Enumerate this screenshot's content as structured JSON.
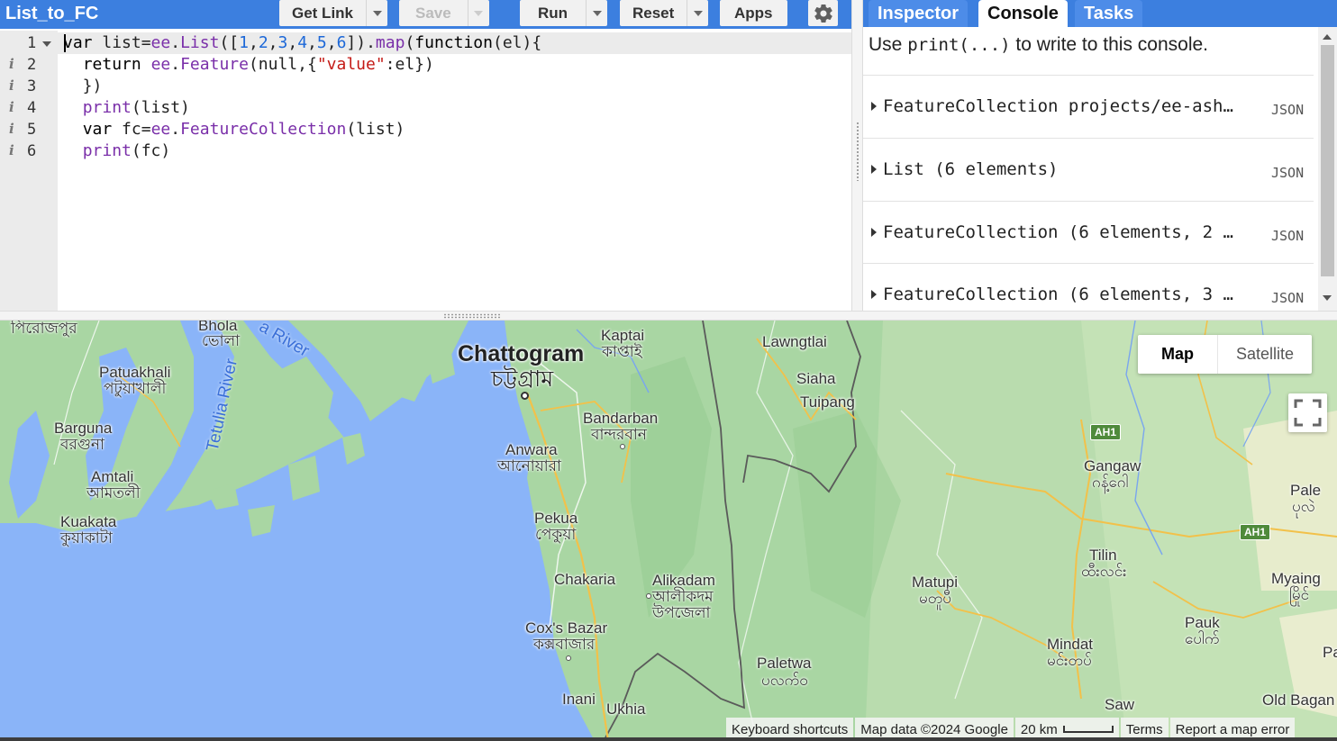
{
  "editor": {
    "script_title": "List_to_FC",
    "buttons": {
      "get_link": "Get Link",
      "save": "Save",
      "run": "Run",
      "reset": "Reset",
      "apps": "Apps"
    },
    "line_numbers": [
      "1",
      "2",
      "3",
      "4",
      "5",
      "6"
    ],
    "info_marker": "i"
  },
  "right_panel": {
    "tabs": [
      "Inspector",
      "Console",
      "Tasks"
    ],
    "active_tab": "Console",
    "console_hint_prefix": "Use ",
    "console_hint_code": "print(...)",
    "console_hint_suffix": " to write to this console.",
    "entries": [
      {
        "text": "FeatureCollection projects/ee-ash…",
        "json_label": "JSON"
      },
      {
        "text": "List (6 elements)",
        "json_label": "JSON"
      },
      {
        "text": "FeatureCollection (6 elements, 2 …",
        "json_label": "JSON"
      },
      {
        "text": "FeatureCollection (6 elements, 3 …",
        "json_label": "JSON"
      }
    ]
  },
  "map": {
    "map_type": {
      "map": "Map",
      "satellite": "Satellite",
      "selected": "Map"
    },
    "places": {
      "chattogram": "Chattogram",
      "chattogram_bn": "চট্টগ্রাম",
      "pirojpur_bn": "পিরোজপুর",
      "bhola": "Bhola",
      "bhola_bn": "ভোলা",
      "patuakhali": "Patuakhali",
      "patuakhali_bn": "পটুয়াখালী",
      "barguna": "Barguna",
      "barguna_bn": "বরগুনা",
      "amtali": "Amtali",
      "amtali_bn": "আমতলী",
      "kuakata": "Kuakata",
      "kuakata_bn": "কুয়াকাটা",
      "kaptai": "Kaptai",
      "kaptai_bn": "কাপ্তাই",
      "bandarban": "Bandarban",
      "bandarban_bn": "বান্দরবান",
      "anwara": "Anwara",
      "anwara_bn": "আনোয়ারা",
      "pekua": "Pekua",
      "pekua_bn": "পেকুয়া",
      "chakaria": "Chakaria",
      "alikadam": "Alikadam",
      "alikadam_bn": "আলীকদম",
      "alikadam_bn2": "উপজেলা",
      "coxs_bazar": "Cox's Bazar",
      "coxs_bazar_bn": "কক্সবাজার",
      "inani": "Inani",
      "ukhia": "Ukhia",
      "lawngtlai": "Lawngtlai",
      "siaha": "Siaha",
      "tuipang": "Tuipang",
      "paletwa": "Paletwa",
      "paletwa_my": "ပလက်ဝ",
      "matupi": "Matupi",
      "matupi_my": "မတူပီ",
      "gangaw": "Gangaw",
      "gangaw_my": "ဂန့်ဂေါ",
      "tilin": "Tilin",
      "tilin_my": "ထီးလင်း",
      "mindat": "Mindat",
      "mindat_my": "မင်းတပ်",
      "pale": "Pale",
      "pale_my": "ပုလဲ",
      "myaing": "Myaing",
      "myaing_my": "မြိုင်",
      "pauk": "Pauk",
      "pauk_my": "ပေါက်",
      "saw": "Saw",
      "old_bagan": "Old Bagan",
      "pa": "Pa"
    },
    "rivers": {
      "tetulia": "Tetulia River",
      "river_fragment": "a River"
    },
    "shields": {
      "ah1_a": "AH1",
      "ah1_b": "AH1"
    },
    "attribution": {
      "keyboard": "Keyboard shortcuts",
      "map_data": "Map data ©2024 Google",
      "scale": "20 km",
      "terms": "Terms",
      "report": "Report a map error"
    }
  }
}
